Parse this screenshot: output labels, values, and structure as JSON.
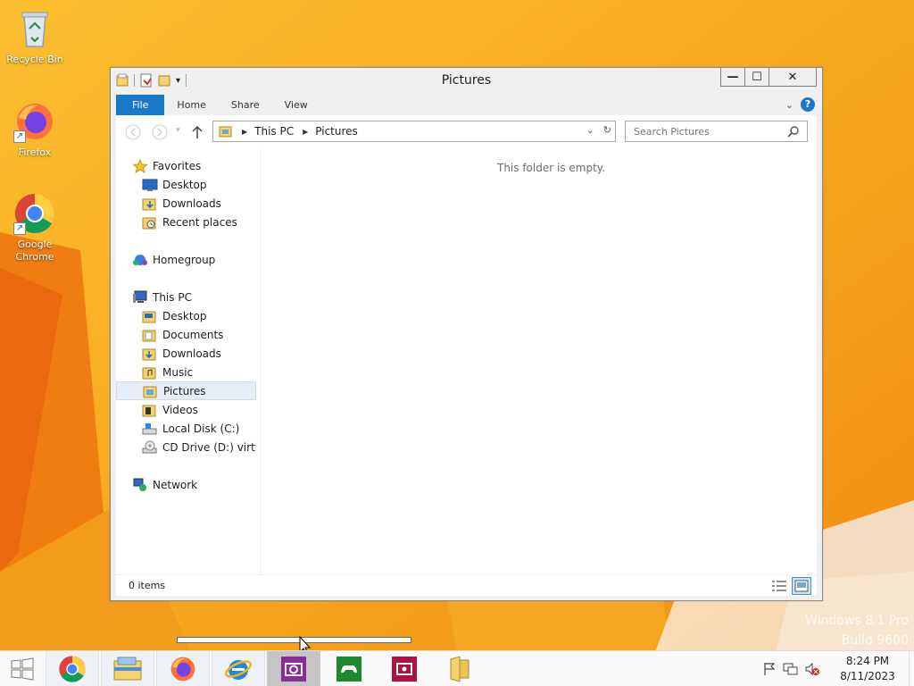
{
  "desktop": {
    "icons": [
      {
        "label": "Recycle Bin",
        "icon": "recycle-bin-icon"
      },
      {
        "label": "Firefox",
        "icon": "firefox-icon"
      },
      {
        "label": "Google Chrome",
        "icon": "chrome-icon"
      }
    ],
    "watermark": {
      "line1": "Windows 8.1 Pro",
      "line2": "Build 9600"
    }
  },
  "window": {
    "title": "Pictures",
    "controls": {
      "minimize": "—",
      "maximize": "☐",
      "close": "✕"
    },
    "ribbon_tabs": [
      "File",
      "Home",
      "Share",
      "View"
    ],
    "help_label": "?",
    "address": {
      "crumbs": [
        "This PC",
        "Pictures"
      ]
    },
    "search": {
      "placeholder": "Search Pictures"
    },
    "nav_groups": [
      {
        "label": "Favorites",
        "icon": "star-icon",
        "items": [
          {
            "label": "Desktop",
            "icon": "desktop-icon"
          },
          {
            "label": "Downloads",
            "icon": "downloads-folder-icon"
          },
          {
            "label": "Recent places",
            "icon": "recent-places-icon"
          }
        ]
      },
      {
        "label": "Homegroup",
        "icon": "homegroup-icon",
        "items": []
      },
      {
        "label": "This PC",
        "icon": "computer-icon",
        "items": [
          {
            "label": "Desktop",
            "icon": "folder-icon"
          },
          {
            "label": "Documents",
            "icon": "folder-icon"
          },
          {
            "label": "Downloads",
            "icon": "folder-icon"
          },
          {
            "label": "Music",
            "icon": "folder-icon"
          },
          {
            "label": "Pictures",
            "icon": "folder-icon",
            "selected": true
          },
          {
            "label": "Videos",
            "icon": "folder-icon"
          },
          {
            "label": "Local Disk (C:)",
            "icon": "drive-icon"
          },
          {
            "label": "CD Drive (D:) virtio-win",
            "icon": "cd-drive-icon"
          }
        ]
      },
      {
        "label": "Network",
        "icon": "network-icon",
        "items": []
      }
    ],
    "empty_message": "This folder is empty.",
    "status": {
      "item_count": "0 items"
    }
  },
  "progress": {
    "fraction": 0.52
  },
  "taskbar": {
    "items": [
      "start-button",
      "chrome-icon",
      "file-explorer-icon",
      "firefox-icon",
      "internet-explorer-icon",
      "camera-icon",
      "xbox-games-icon",
      "photo-viewer-icon",
      "folder-icon"
    ],
    "clock": {
      "time": "8:24 PM",
      "date": "8/11/2023"
    }
  },
  "colors": {
    "accent": "#1979ca",
    "wallpaper": "#f7a51c"
  }
}
